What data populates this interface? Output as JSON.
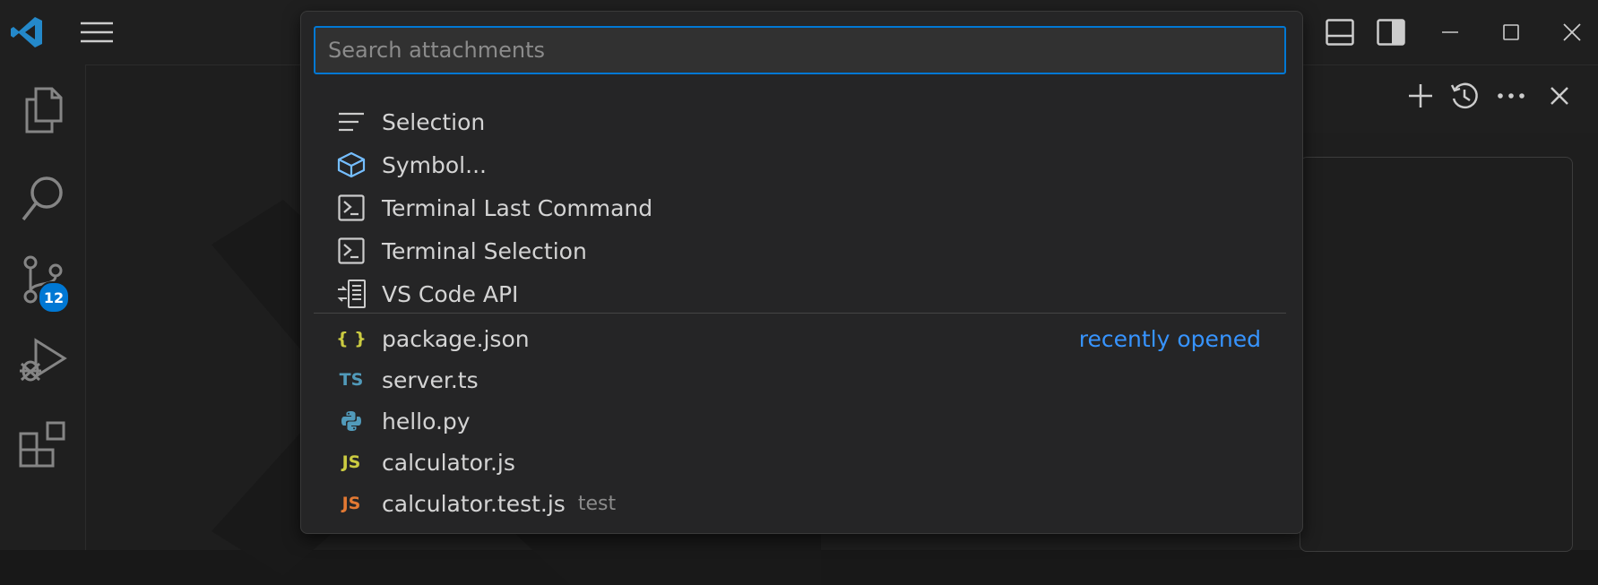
{
  "search": {
    "placeholder": "Search attachments",
    "value": ""
  },
  "context_items": [
    {
      "label": "Selection",
      "icon": "selection-icon"
    },
    {
      "label": "Symbol...",
      "icon": "symbol-icon"
    },
    {
      "label": "Terminal Last Command",
      "icon": "terminal-icon"
    },
    {
      "label": "Terminal Selection",
      "icon": "terminal-icon"
    },
    {
      "label": "VS Code API",
      "icon": "vscode-api-icon"
    }
  ],
  "file_items": [
    {
      "label": "package.json",
      "icon": "json-file-icon",
      "icon_text": "{ }",
      "icon_color": "#cbcb41",
      "description": "",
      "right_label": "recently opened"
    },
    {
      "label": "server.ts",
      "icon": "typescript-file-icon",
      "icon_text": "TS",
      "icon_color": "#519aba",
      "description": "",
      "right_label": ""
    },
    {
      "label": "hello.py",
      "icon": "python-file-icon",
      "icon_text": "",
      "icon_color": "#519aba",
      "description": "",
      "right_label": ""
    },
    {
      "label": "calculator.js",
      "icon": "javascript-file-icon",
      "icon_text": "JS",
      "icon_color": "#cbcb41",
      "description": "",
      "right_label": ""
    },
    {
      "label": "calculator.test.js",
      "icon": "javascript-test-file-icon",
      "icon_text": "JS",
      "icon_color": "#e37933",
      "description": "test",
      "right_label": ""
    }
  ],
  "activity_bar": {
    "items": [
      "explorer-icon",
      "search-icon",
      "source-control-icon",
      "run-debug-icon",
      "extensions-icon"
    ],
    "source_control_badge": "12"
  },
  "colors": {
    "accent": "#0078d4",
    "link": "#3794ff",
    "background": "#1f1f1f"
  }
}
